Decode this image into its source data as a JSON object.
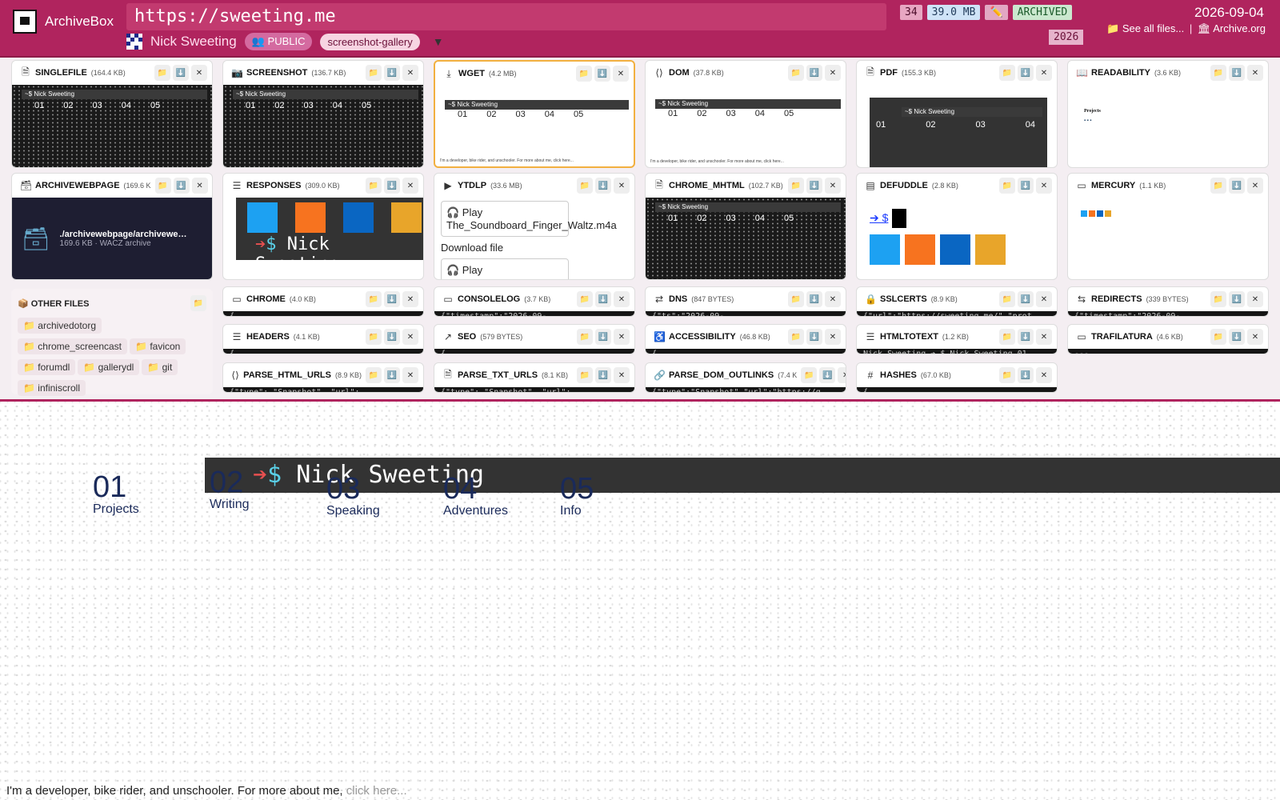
{
  "header": {
    "brand": "ArchiveBox",
    "url": "https://sweeting.me",
    "title": "Nick Sweeting",
    "public_label": "👥 PUBLIC",
    "tag": "screenshot-gallery",
    "caret": "▼",
    "count": "34",
    "size": "39.0 MB",
    "edit_icon": "✏️",
    "status": "ARCHIVED",
    "year": "2026",
    "date": "2026-09-04",
    "see_all": "📁 See all files...",
    "separator": "|",
    "archive_org": "🏛 Archive.org"
  },
  "cards": [
    {
      "name": "SINGLEFILE",
      "size": "(164.4 KB)"
    },
    {
      "name": "SCREENSHOT",
      "size": "(136.7 KB)"
    },
    {
      "name": "WGET",
      "size": "(4.2 MB)"
    },
    {
      "name": "DOM",
      "size": "(37.8 KB)"
    },
    {
      "name": "PDF",
      "size": "(155.3 KB)"
    },
    {
      "name": "READABILITY",
      "size": "(3.6 KB)"
    },
    {
      "name": "ARCHIVEWEBPAGE",
      "size": "(169.6 K"
    },
    {
      "name": "RESPONSES",
      "size": "(309.0 KB)"
    },
    {
      "name": "YTDLP",
      "size": "(33.6 MB)"
    },
    {
      "name": "CHROME_MHTML",
      "size": "(102.7 KB)"
    },
    {
      "name": "DEFUDDLE",
      "size": "(2.8 KB)"
    },
    {
      "name": "MERCURY",
      "size": "(1.1 KB)"
    },
    {
      "name": "CHROME",
      "size": "(4.0 KB)",
      "text": "{…"
    },
    {
      "name": "CONSOLELOG",
      "size": "(3.7 KB)",
      "text": "{\"timestamp\":\"2026-09-…"
    },
    {
      "name": "DNS",
      "size": "(847 BYTES)",
      "text": "{\"ts\":\"2026-09-…"
    },
    {
      "name": "SSLCERTS",
      "size": "(8.9 KB)",
      "text": "{\"url\":\"https://sweeting.me/\",\"prot…"
    },
    {
      "name": "REDIRECTS",
      "size": "(339 BYTES)",
      "text": "{\"timestamp\":\"2026-09-…"
    },
    {
      "name": "HEADERS",
      "size": "(4.1 KB)",
      "text": "{…"
    },
    {
      "name": "SEO",
      "size": "(579 BYTES)",
      "text": "{…"
    },
    {
      "name": "ACCESSIBILITY",
      "size": "(46.8 KB)",
      "text": "{…"
    },
    {
      "name": "HTMLTOTEXT",
      "size": "(1.2 KB)",
      "text": "Nick Sweeting ➔ $ Nick Sweeting 01 …"
    },
    {
      "name": "TRAFILATURA",
      "size": "(4.6 KB)",
      "text": "---…"
    },
    {
      "name": "PARSE_HTML_URLS",
      "size": "(8.9 KB)",
      "text": "{\"type\": \"Snapshot\", \"url\": …"
    },
    {
      "name": "PARSE_TXT_URLS",
      "size": "(8.1 KB)",
      "text": "{\"type\": \"Snapshot\", \"url\": …"
    },
    {
      "name": "PARSE_DOM_OUTLINKS",
      "size": "(7.4 K",
      "text": "{\"type\":\"Snapshot\",\"url\":\"https://g…"
    },
    {
      "name": "HASHES",
      "size": "(67.0 KB)",
      "text": "{…"
    }
  ],
  "archivewebpage": {
    "path": "./archivewebpage/archivewe…",
    "meta": "169.6 KB · WACZ archive"
  },
  "ytdlp": {
    "item1": "🎧 Play The_Soundboard_Finger_Waltz.m4a",
    "download": "Download file",
    "item2": "🎧 Play"
  },
  "defuddle": {
    "prompt": "➔ $"
  },
  "other_files": {
    "title": "📦 OTHER FILES",
    "folders": [
      "archivedotorg",
      "chrome_screencast",
      "favicon",
      "forumdl",
      "gallerydl",
      "git",
      "infiniscroll"
    ]
  },
  "mini": {
    "bar": "~$ Nick Sweeting",
    "nums": [
      "01",
      "02",
      "03",
      "04",
      "05"
    ],
    "tagline": "I'm a developer, bike rider, and unschooler. For more about me, click here..."
  },
  "page": {
    "prompt_arrow": "➔",
    "prompt_dollar": "$",
    "name": "Nick Sweeting",
    "nav": [
      {
        "n": "01",
        "l": "Projects"
      },
      {
        "n": "02",
        "l": "Writing"
      },
      {
        "n": "03",
        "l": "Speaking"
      },
      {
        "n": "04",
        "l": "Adventures"
      },
      {
        "n": "05",
        "l": "Info"
      }
    ],
    "footer_text": "I'm a developer, bike rider, and unschooler. For more about me,",
    "footer_link": "click here..."
  },
  "icons": {
    "folder": "📁",
    "download": "⬇️",
    "close": "✕"
  }
}
